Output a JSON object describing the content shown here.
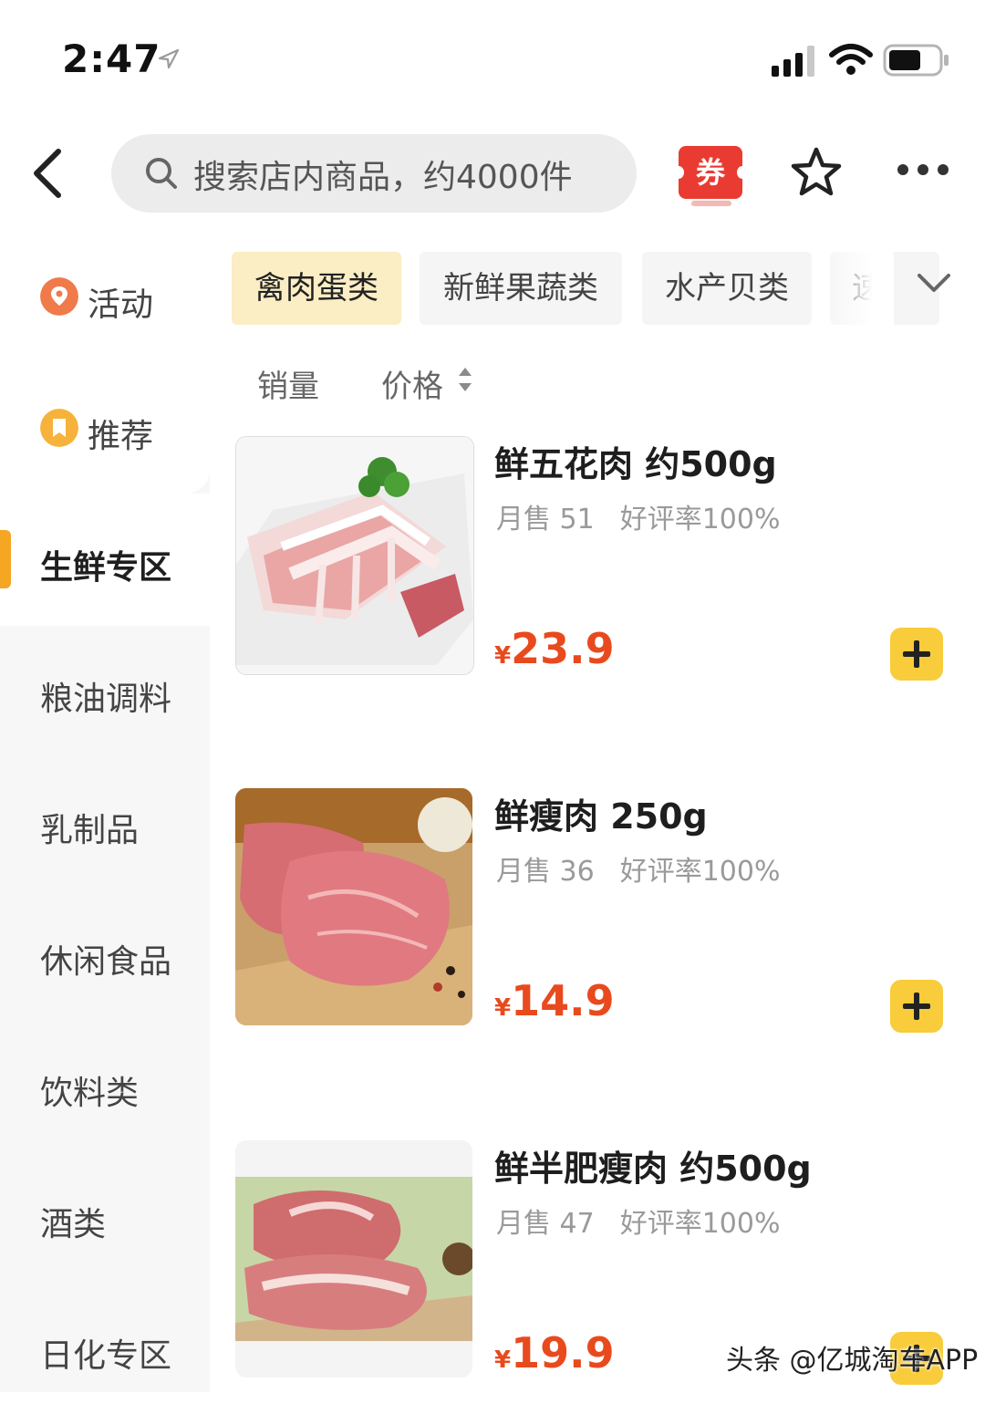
{
  "status_bar": {
    "time": "2:47"
  },
  "search": {
    "placeholder": "搜索店内商品，约4000件"
  },
  "nav": {
    "coupon_label": "券"
  },
  "sidebar": {
    "items": [
      {
        "label": "活动",
        "icon": "activity-icon"
      },
      {
        "label": "推荐",
        "icon": "recommend-icon"
      },
      {
        "label": "生鲜专区",
        "active": true
      },
      {
        "label": "粮油调料"
      },
      {
        "label": "乳制品"
      },
      {
        "label": "休闲食品"
      },
      {
        "label": "饮料类"
      },
      {
        "label": "酒类"
      },
      {
        "label": "日化专区"
      }
    ]
  },
  "categories": {
    "chips": [
      "禽肉蛋类",
      "新鲜果蔬类",
      "水产贝类",
      "速"
    ],
    "active_index": 0
  },
  "sort": {
    "sales_label": "销量",
    "price_label": "价格"
  },
  "products": [
    {
      "name": "鲜五花肉 约500g",
      "monthly_sales": "月售 51",
      "rating": "好评率100%",
      "currency": "¥",
      "price": "23.9"
    },
    {
      "name": "鲜瘦肉 250g",
      "monthly_sales": "月售 36",
      "rating": "好评率100%",
      "currency": "¥",
      "price": "14.9"
    },
    {
      "name": "鲜半肥瘦肉 约500g",
      "monthly_sales": "月售 47",
      "rating": "好评率100%",
      "currency": "¥",
      "price": "19.9"
    }
  ],
  "watermark": "头条 @亿城淘车APP",
  "colors": {
    "accent_yellow": "#f8cc3a",
    "price_red": "#e84a1e",
    "coupon_red": "#ea3b32",
    "indicator_orange": "#f5a623"
  }
}
